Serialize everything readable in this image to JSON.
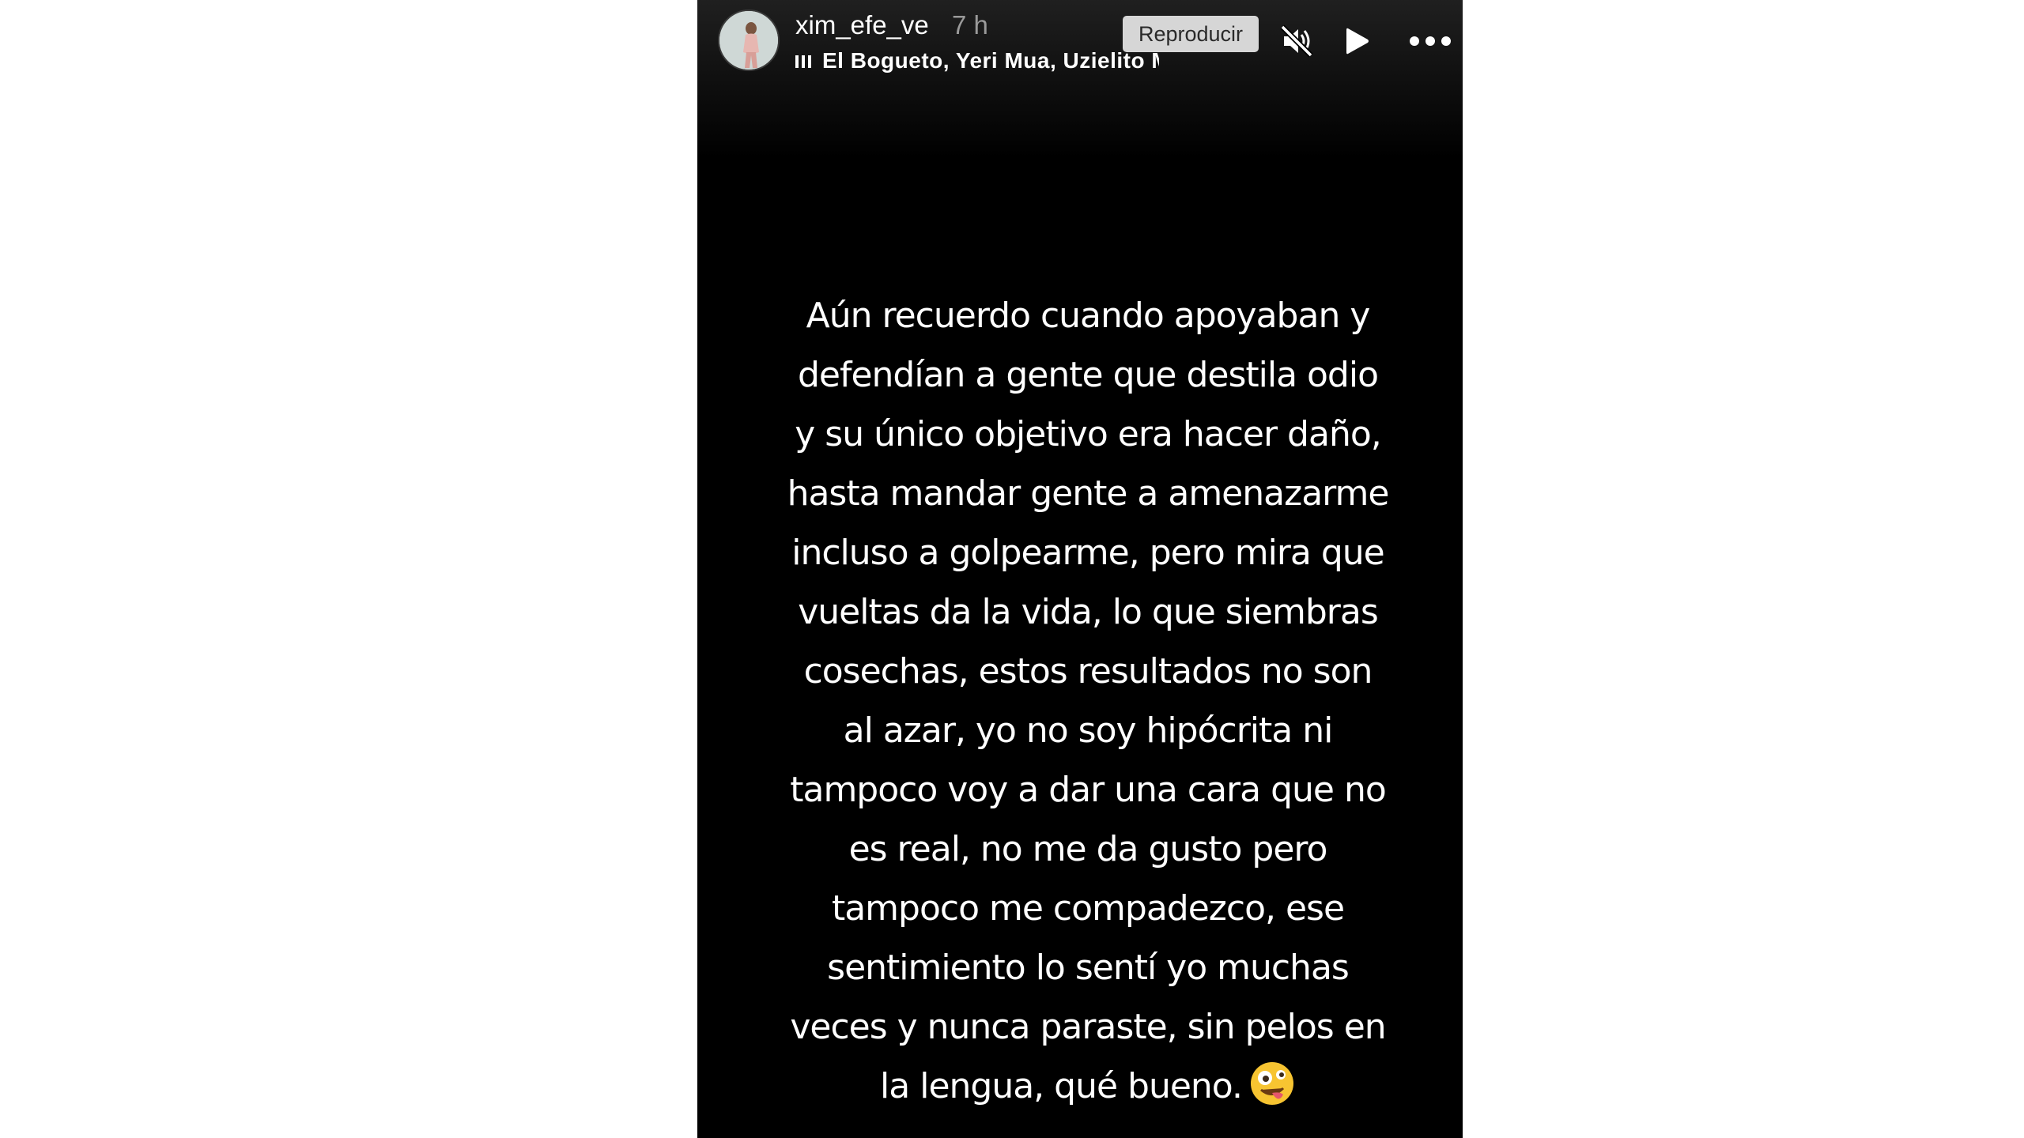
{
  "story": {
    "username": "xim_efe_ve",
    "time_ago": "7 h",
    "music": "El Bogueto, Yeri Mua, Uzielito Mix · Ne",
    "tooltip": "Reproducir",
    "text": "Aún recuerdo cuando apoyaban y\ndefendían a gente que destila odio\ny su único objetivo era hacer daño,\nhasta mandar gente a amenazarme\nincluso a golpearme, pero mira que\nvueltas da la vida, lo que siembras\ncosechas, estos resultados no son\nal azar, yo no soy hipócrita ni\ntampoco voy a dar una cara que no\nes real, no me da gusto pero\ntampoco me compadezco, ese\nsentimiento lo sentí yo muchas\nveces y nunca paraste, sin pelos en\nla lengua, qué bueno.",
    "emoji": "zany-face"
  },
  "icons": {
    "music": "music-bars-icon",
    "mute": "speaker-muted-icon",
    "play": "play-icon",
    "more": "more-options-icon"
  },
  "colors": {
    "background": "#000000",
    "text": "#ffffff",
    "time": "#9a9a9a",
    "tooltip_bg": "#d6d6d6"
  }
}
